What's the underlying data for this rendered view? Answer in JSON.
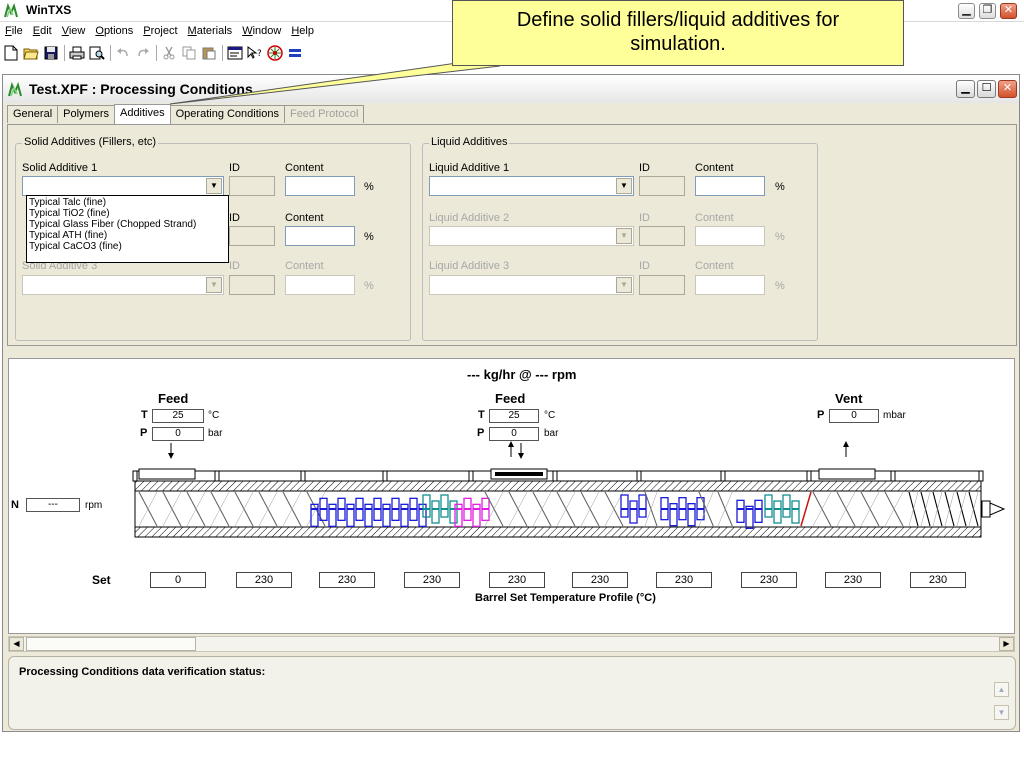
{
  "app": {
    "title": "WinTXS"
  },
  "menu": [
    "File",
    "Edit",
    "View",
    "Options",
    "Project",
    "Materials",
    "Window",
    "Help"
  ],
  "callout": {
    "line1": "Define solid fillers/liquid additives for",
    "line2": "simulation."
  },
  "child": {
    "title": "Test.XPF : Processing Conditions",
    "tabs": [
      {
        "label": "General",
        "state": "normal"
      },
      {
        "label": "Polymers",
        "state": "normal"
      },
      {
        "label": "Additives",
        "state": "active"
      },
      {
        "label": "Operating Conditions",
        "state": "normal"
      },
      {
        "label": "Feed Protocol",
        "state": "disabled"
      }
    ]
  },
  "solid": {
    "legend": "Solid Additives (Fillers, etc)",
    "a1_label": "Solid Additive 1",
    "a3_label_partial": "Solid Additive 3",
    "id_label": "ID",
    "content_label": "Content",
    "unit": "%",
    "options": [
      "Typical Talc  (fine)",
      "Typical TiO2  (fine)",
      "Typical Glass Fiber  (Chopped Strand)",
      "Typical ATH  (fine)",
      "Typical CaCO3  (fine)"
    ]
  },
  "liquid": {
    "legend": "Liquid Additives",
    "a1_label": "Liquid Additive 1",
    "a2_label": "Liquid Additive 2",
    "a3_label": "Liquid Additive 3",
    "id_label": "ID",
    "content_label": "Content",
    "unit": "%"
  },
  "extruder": {
    "throughput": "--- kg/hr  @ --- rpm",
    "feed1": {
      "title": "Feed",
      "t_label": "T",
      "t_value": "25",
      "t_unit": "°C",
      "p_label": "P",
      "p_value": "0",
      "p_unit": "bar"
    },
    "feed2": {
      "title": "Feed",
      "t_label": "T",
      "t_value": "25",
      "t_unit": "°C",
      "p_label": "P",
      "p_value": "0",
      "p_unit": "bar"
    },
    "vent": {
      "title": "Vent",
      "p_label": "P",
      "p_value": "0",
      "p_unit": "mbar"
    },
    "speed": {
      "label": "N",
      "value": "---",
      "unit": "rpm"
    },
    "set_label": "Set",
    "set_values": [
      "0",
      "230",
      "230",
      "230",
      "230",
      "230",
      "230",
      "230",
      "230",
      "230"
    ],
    "profile_label": "Barrel Set Temperature Profile (°C)"
  },
  "status": {
    "text": "Processing Conditions data verification status:"
  },
  "colors": {
    "kneading_blue": "#1a1ad6",
    "kneading_teal": "#138f8f",
    "kneading_magenta": "#e01ee0",
    "callout_bg": "#ffff99"
  }
}
